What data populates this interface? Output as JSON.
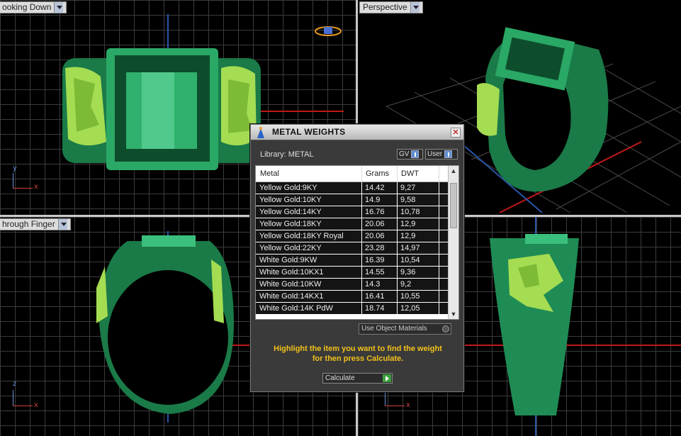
{
  "viewports": {
    "top_left": {
      "label": "ooking Down"
    },
    "top_right": {
      "label": "Perspective"
    },
    "bottom_left": {
      "label": "hrough Finger"
    },
    "bottom_right": {
      "label": ""
    }
  },
  "axes": {
    "x": "x",
    "y": "y",
    "z": "z"
  },
  "dialog": {
    "title": "METAL WEIGHTS",
    "library_label": "Library: METAL",
    "toggle_gv": "GV",
    "toggle_user": "User",
    "columns": {
      "metal": "Metal",
      "grams": "Grams",
      "dwt": "DWT"
    },
    "rows": [
      {
        "metal": "Yellow Gold:9KY",
        "grams": "14.42",
        "dwt": "9,27"
      },
      {
        "metal": "Yellow Gold:10KY",
        "grams": "14.9",
        "dwt": "9,58"
      },
      {
        "metal": "Yellow Gold:14KY",
        "grams": "16.76",
        "dwt": "10,78"
      },
      {
        "metal": "Yellow Gold:18KY",
        "grams": "20.06",
        "dwt": "12,9"
      },
      {
        "metal": "Yellow Gold:18KY Royal",
        "grams": "20.06",
        "dwt": "12,9"
      },
      {
        "metal": "Yellow Gold:22KY",
        "grams": "23.28",
        "dwt": "14,97"
      },
      {
        "metal": "White Gold:9KW",
        "grams": "16.39",
        "dwt": "10,54"
      },
      {
        "metal": "White Gold:10KX1",
        "grams": "14.55",
        "dwt": "9,36"
      },
      {
        "metal": "White Gold:10KW",
        "grams": "14.3",
        "dwt": "9,2"
      },
      {
        "metal": "White Gold:14KX1",
        "grams": "16.41",
        "dwt": "10,55"
      },
      {
        "metal": "White Gold:14K PdW",
        "grams": "18.74",
        "dwt": "12,05"
      }
    ],
    "use_object_materials": "Use Object Materials",
    "hint_line1": "Highlight the item you want to find the weight",
    "hint_line2": "for then press Calculate.",
    "calculate": "Calculate",
    "close_symbol": "✕",
    "scroll_up": "▲",
    "scroll_down": "▼"
  },
  "colors": {
    "ring_green": "#1f8c55",
    "gold_relief": "#9fd94a",
    "hint_yellow": "#f2c21a"
  }
}
